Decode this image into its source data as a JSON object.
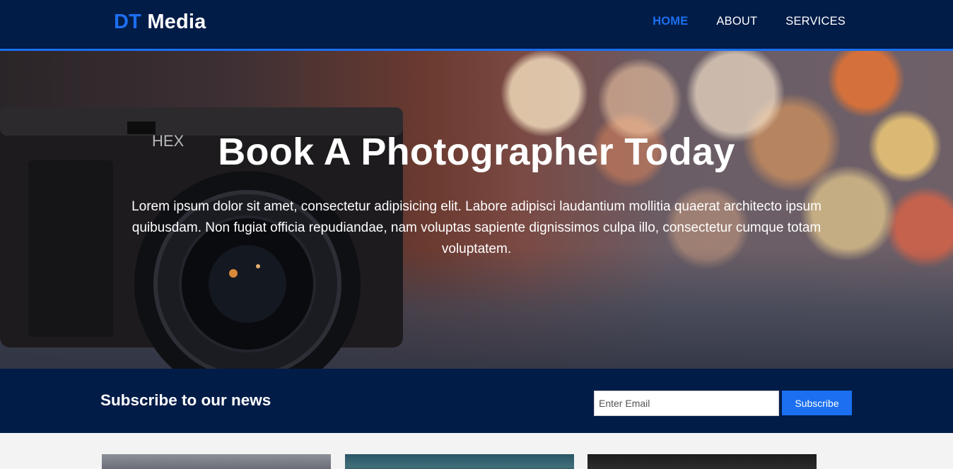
{
  "header": {
    "logo_accent": "DT",
    "logo_text": "Media",
    "nav": [
      {
        "label": "HOME",
        "active": true
      },
      {
        "label": "ABOUT",
        "active": false
      },
      {
        "label": "SERVICES",
        "active": false
      }
    ]
  },
  "hero": {
    "title": "Book A Photographer Today",
    "text": "Lorem ipsum dolor sit amet, consectetur adipisicing elit. Labore adipisci laudantium mollitia quaerat architecto ipsum quibusdam. Non fugiat officia repudiandae, nam voluptas sapiente dignissimos culpa illo, consectetur cumque totam voluptatem.",
    "camera_brand": "HEX"
  },
  "subscribe": {
    "title": "Subscribe to our news",
    "email_placeholder": "Enter Email",
    "email_value": "",
    "button_label": "Subscribe"
  },
  "colors": {
    "navy": "#021c48",
    "accent": "#1b6ff0",
    "text_light": "#ffffff"
  }
}
